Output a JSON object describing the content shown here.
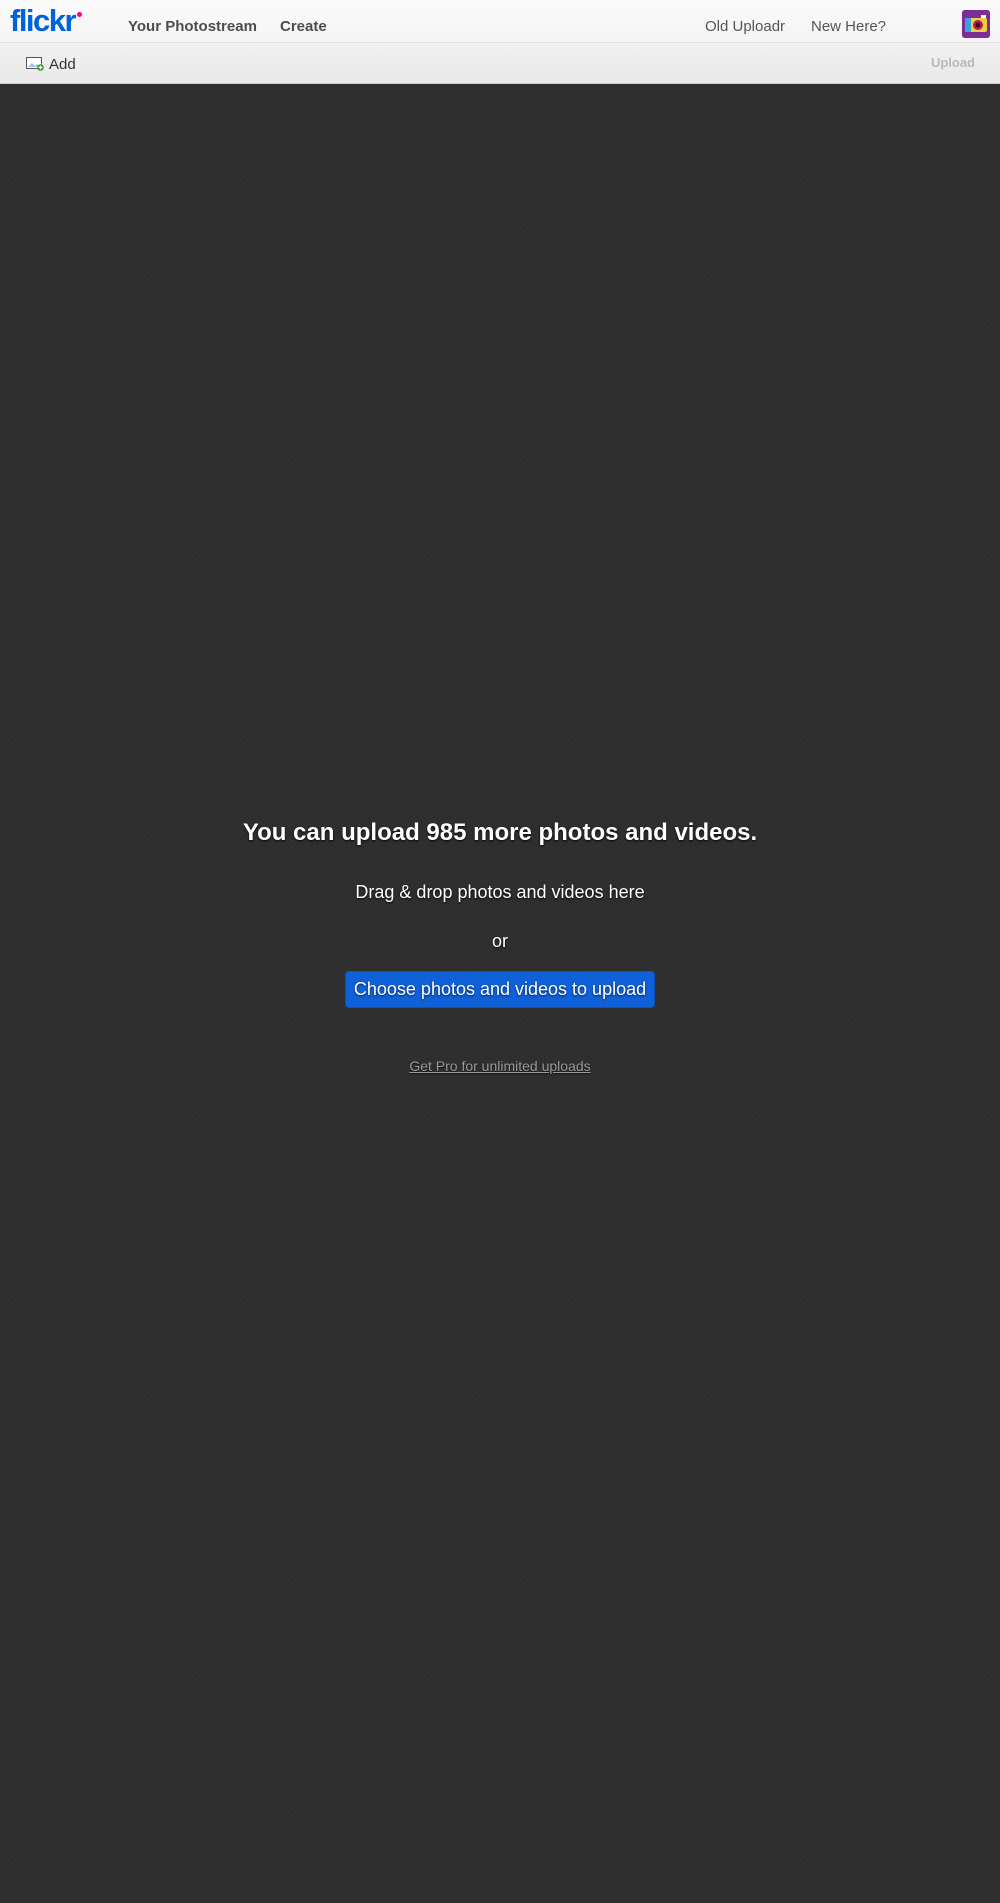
{
  "header": {
    "logo_text": "flickr",
    "nav_left": [
      "Your Photostream",
      "Create"
    ],
    "nav_right": [
      "Old Uploadr",
      "New Here?"
    ],
    "avatar_icon": "user-avatar"
  },
  "toolbar": {
    "add_label": "Add",
    "add_icon": "add-photo-icon",
    "upload_label": "Upload"
  },
  "dropzone": {
    "headline": "You can upload 985 more photos and videos.",
    "drag_text": "Drag & drop photos and videos here",
    "or_text": "or",
    "choose_button": "Choose photos and videos to upload",
    "pro_link": "Get Pro for unlimited uploads"
  },
  "colors": {
    "brand_blue": "#0063dc",
    "brand_pink": "#ff0084",
    "button_blue": "#1060d8",
    "background": "#2e2e2e"
  }
}
